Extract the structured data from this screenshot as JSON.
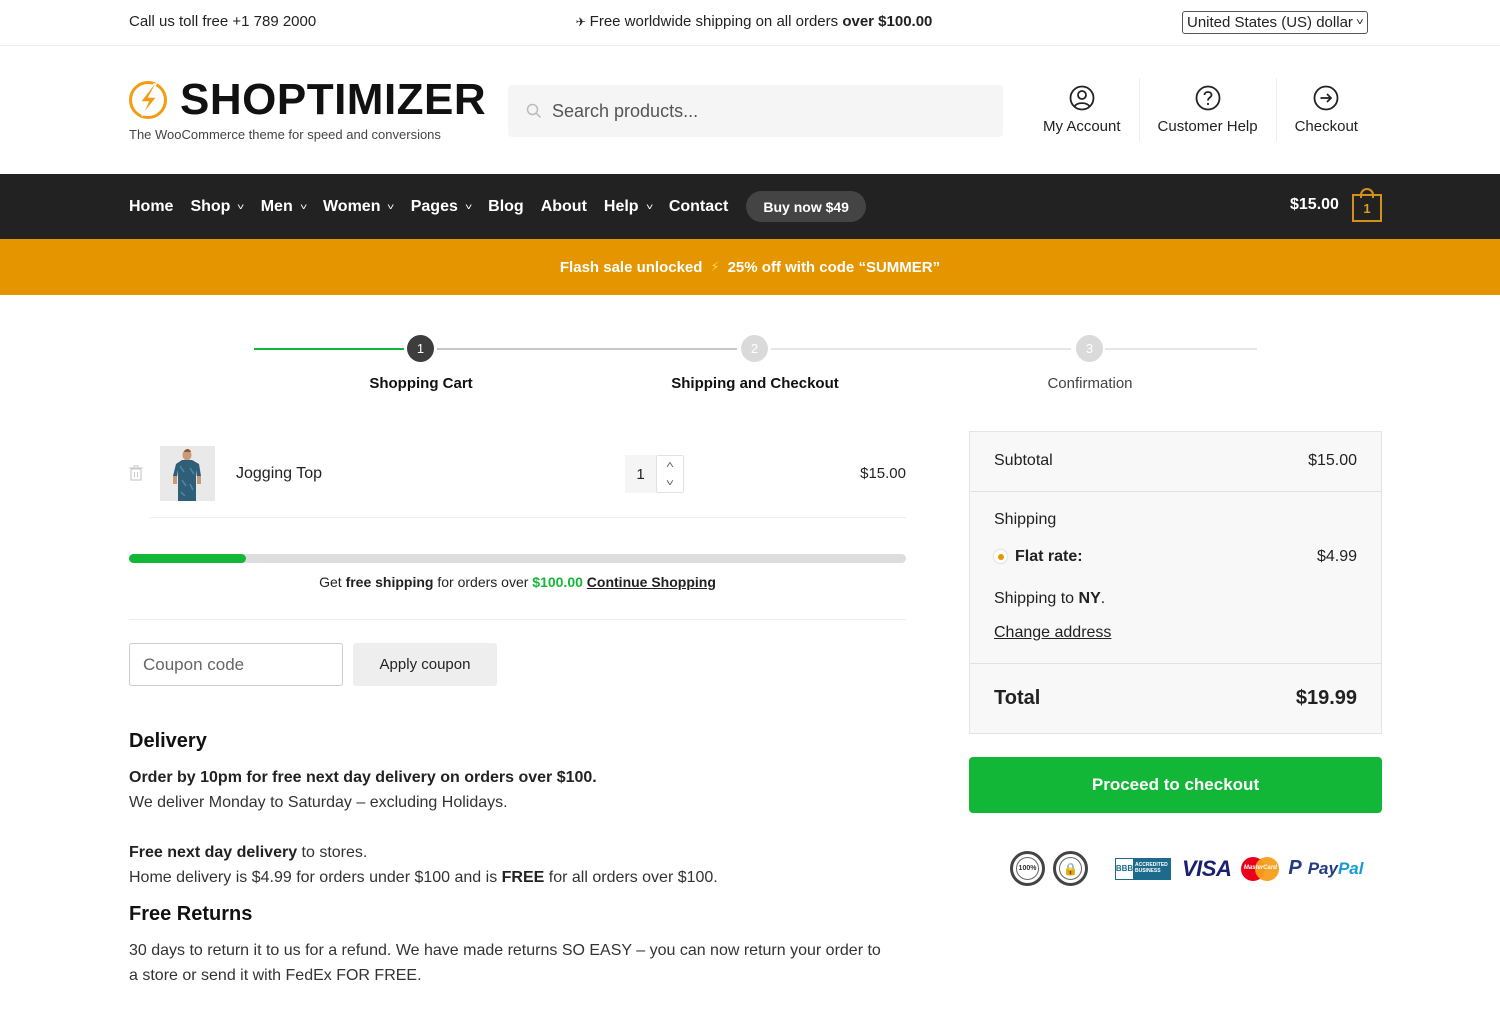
{
  "topbar": {
    "phone_text": "Call us toll free +1 789 2000",
    "shipping_text_prefix": "Free worldwide shipping on all orders ",
    "shipping_text_bold": "over $100.00",
    "plane_icon": "✈",
    "currency_selected": "United States (US) dollar"
  },
  "header": {
    "logo_text": "SHOPTIMIZER",
    "tagline": "The WooCommerce theme for speed and conversions",
    "search_placeholder": "Search products...",
    "links": [
      {
        "label": "My Account",
        "icon": "user-circle-icon"
      },
      {
        "label": "Customer Help",
        "icon": "question-circle-icon"
      },
      {
        "label": "Checkout",
        "icon": "arrow-right-circle-icon"
      }
    ]
  },
  "nav": {
    "items": [
      {
        "label": "Home",
        "dropdown": false
      },
      {
        "label": "Shop",
        "dropdown": true
      },
      {
        "label": "Men",
        "dropdown": true
      },
      {
        "label": "Women",
        "dropdown": true
      },
      {
        "label": "Pages",
        "dropdown": true
      },
      {
        "label": "Blog",
        "dropdown": false
      },
      {
        "label": "About",
        "dropdown": false
      },
      {
        "label": "Help",
        "dropdown": true
      },
      {
        "label": "Contact",
        "dropdown": false
      }
    ],
    "buy_now_label": "Buy now $49",
    "cart_total": "$15.00",
    "cart_count": "1"
  },
  "flash": {
    "text_left": "Flash sale unlocked",
    "bolt": "⚡",
    "text_right": "25% off with code “SUMMER”"
  },
  "steps": [
    {
      "number": "1",
      "label": "Shopping Cart",
      "state": "active"
    },
    {
      "number": "2",
      "label": "Shipping and Checkout",
      "state": "upcoming"
    },
    {
      "number": "3",
      "label": "Confirmation",
      "state": "upcoming"
    }
  ],
  "cart": {
    "items": [
      {
        "name": "Jogging Top",
        "quantity": "1",
        "price": "$15.00"
      }
    ],
    "free_shipping_progress": 0.15,
    "progress_msg": {
      "get": "Get ",
      "free_shipping": "free shipping",
      "for_orders_over": " for orders over ",
      "threshold": "$100.00",
      "continue_link": "Continue Shopping"
    },
    "coupon_placeholder": "Coupon code",
    "apply_coupon_label": "Apply coupon"
  },
  "info": {
    "delivery_title": "Delivery",
    "delivery_line1": "Order by 10pm for free next day delivery on orders over $100.",
    "delivery_line2": "We deliver Monday to Saturday – excluding Holidays.",
    "delivery_line3_bold": "Free next day delivery",
    "delivery_line3_rest": " to stores.",
    "delivery_line4_a": "Home delivery is $4.99 for orders under $100 and is ",
    "delivery_line4_bold": "FREE",
    "delivery_line4_b": " for all orders over $100.",
    "returns_title": "Free Returns",
    "returns_text": "30 days to return it to us for a refund. We have made returns SO EASY – you can now return your order to a store or send it with FedEx FOR FREE."
  },
  "totals": {
    "subtotal_label": "Subtotal",
    "subtotal_value": "$15.00",
    "shipping_label": "Shipping",
    "flat_rate_label": "Flat rate:",
    "flat_rate_value": "$4.99",
    "shipping_to_prefix": "Shipping to ",
    "shipping_to_state": "NY",
    "change_address_label": "Change address",
    "total_label": "Total",
    "total_value": "$19.99"
  },
  "checkout_button_label": "Proceed to checkout",
  "trust_badges": {
    "satisfaction": "100%",
    "secure": "🔒",
    "bbb_left": "BBB",
    "bbb_right": "ACCREDITED BUSINESS",
    "visa": "VISA",
    "mastercard": "MasterCard",
    "paypal_p": "P",
    "paypal_1": "Pay",
    "paypal_2": "Pal"
  },
  "colors": {
    "accent_orange": "#e59500",
    "green": "#13b738",
    "nav_bg": "#222222"
  }
}
